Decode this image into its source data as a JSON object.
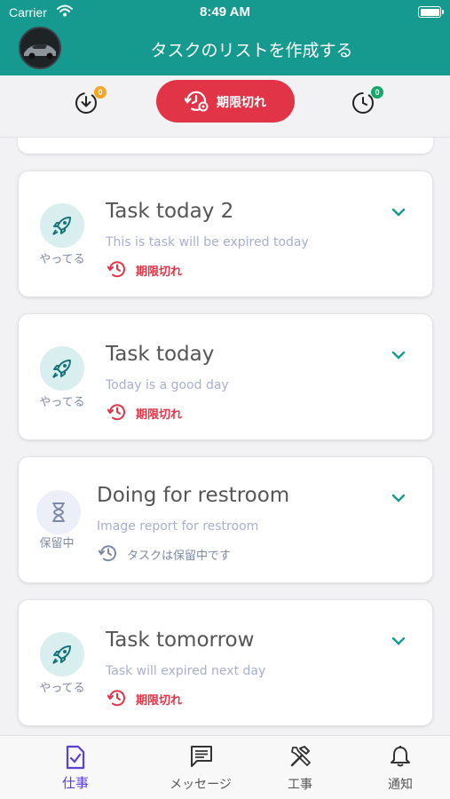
{
  "status_bar": {
    "carrier": "Carrier",
    "time": "8:49 AM"
  },
  "header": {
    "title": "タスクのリストを作成する",
    "avatar": "car-avatar"
  },
  "filters": {
    "todo_badge": "0",
    "done_badge": "0",
    "expired_label": "期限切れ"
  },
  "tasks": [
    {
      "title": "Task today 2",
      "description": "This is task will be expired today",
      "state_label": "やってる",
      "status_text": "期限切れ"
    },
    {
      "title": "Task today",
      "description": "Today is a good day",
      "state_label": "やってる",
      "status_text": "期限切れ"
    },
    {
      "title": "Doing for restroom",
      "description": "Image report for restroom",
      "state_label": "保留中",
      "status_text": "タスクは保留中です"
    },
    {
      "title": "Task tomorrow",
      "description": "Task will expired next day",
      "state_label": "やってる",
      "status_text": "期限切れ"
    }
  ],
  "tabs": [
    {
      "label": "仕事",
      "icon": "task-check-icon"
    },
    {
      "label": "メッセージ",
      "icon": "message-icon"
    },
    {
      "label": "工事",
      "icon": "tools-icon"
    },
    {
      "label": "通知",
      "icon": "bell-icon"
    }
  ],
  "colors": {
    "header": "#16998f",
    "expired": "#e23447",
    "active_tab": "#5b3fd6",
    "badge_orange": "#f5a623",
    "badge_green": "#14a96a"
  }
}
